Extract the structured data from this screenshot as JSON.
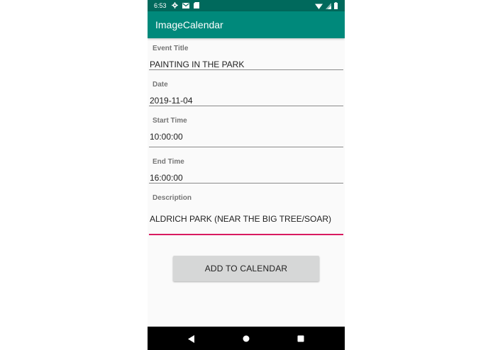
{
  "status_bar": {
    "time": "6:53",
    "left_icons": [
      "gear-icon",
      "mail-icon",
      "sd-card-icon"
    ],
    "right_icons": [
      "wifi-icon",
      "signal-icon",
      "battery-icon"
    ]
  },
  "app_bar": {
    "title": "ImageCalendar"
  },
  "form": {
    "event_title": {
      "label": "Event Title",
      "value": "PAINTING IN THE PARK"
    },
    "date": {
      "label": "Date",
      "value": "2019-11-04"
    },
    "start_time": {
      "label": "Start Time",
      "value": "10:00:00"
    },
    "end_time": {
      "label": "End Time",
      "value": "16:00:00"
    },
    "description": {
      "label": "Description",
      "value": "ALDRICH PARK (NEAR THE BIG TREE/SOAR)"
    }
  },
  "add_button": {
    "label": "ADD TO CALENDAR"
  },
  "nav_bar": {
    "buttons": [
      "back-icon",
      "home-icon",
      "recents-icon"
    ]
  },
  "colors": {
    "status_bar": "#00695c",
    "app_bar": "#00897b",
    "accent": "#d81b60",
    "background": "#fafafa"
  }
}
